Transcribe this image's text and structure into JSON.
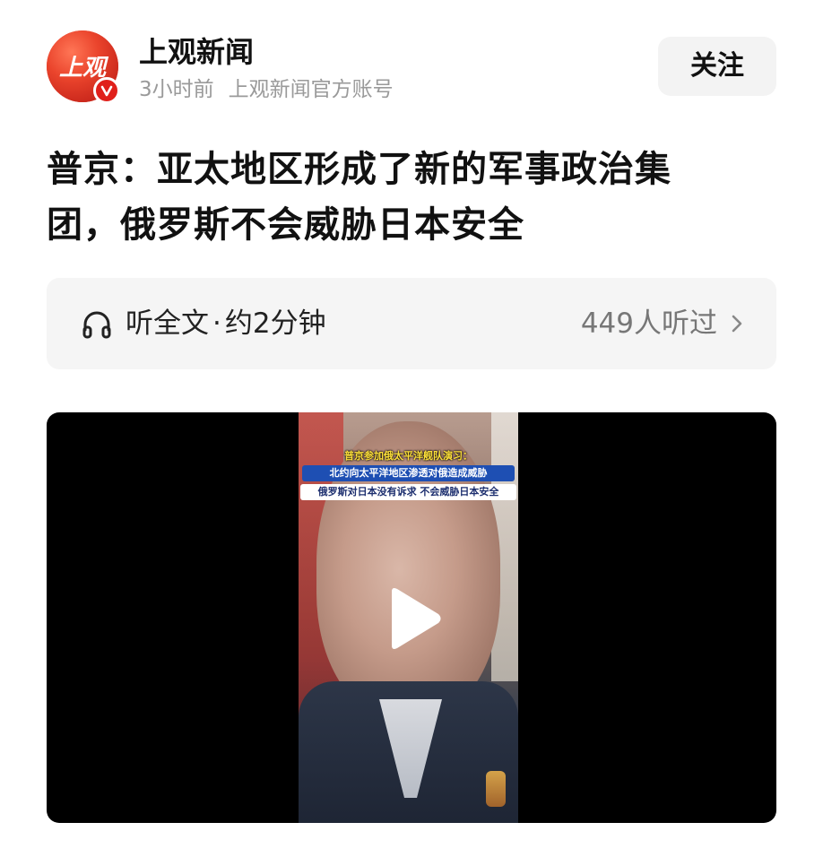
{
  "header": {
    "avatar_text": "上观",
    "account_name": "上观新闻",
    "time_ago": "3小时前",
    "account_desc": "上观新闻官方账号",
    "follow_label": "关注",
    "verified_mark": "V"
  },
  "article": {
    "title_line1": "普京：亚太地区形成了新的军事政治集",
    "title_line2": "团，俄罗斯不会威胁日本安全"
  },
  "listen": {
    "label": "听全文",
    "separator": "·",
    "duration": "约2分钟",
    "listeners": "449人听过"
  },
  "video": {
    "caption_line1": "普京参加俄太平洋舰队演习：",
    "caption_line2": "北约向太平洋地区渗透对俄造成威胁",
    "caption_line3": "俄罗斯对日本没有诉求 不会威胁日本安全"
  },
  "colors": {
    "brand_red": "#e0201b",
    "text_primary": "#111111",
    "text_secondary": "#9a9a9a",
    "panel_bg": "#f5f5f5"
  },
  "icons": [
    "verified-icon",
    "headphone-icon",
    "chevron-right-icon",
    "play-icon"
  ]
}
